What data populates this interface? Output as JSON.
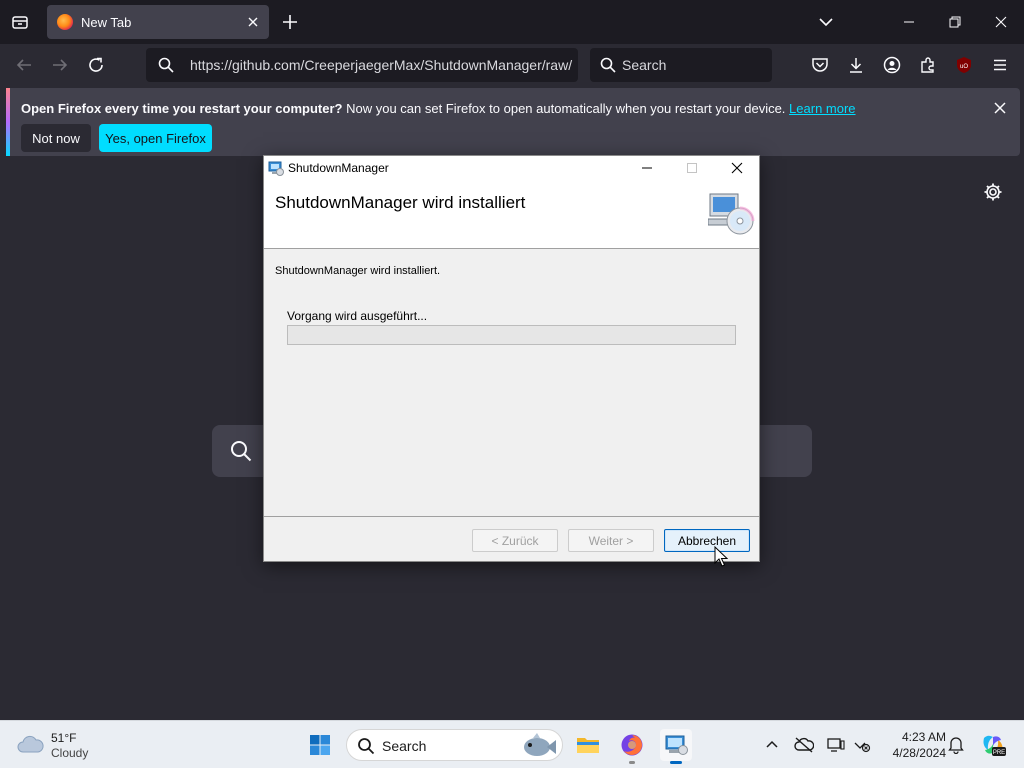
{
  "browser": {
    "tab_title": "New Tab",
    "url": "https://github.com/CreeperjaegerMax/ShutdownManager/raw/",
    "search_placeholder": "Search"
  },
  "notification": {
    "bold_text": "Open Firefox every time you restart your computer?",
    "text": " Now you can set Firefox to open automatically when you restart your device. ",
    "link": "Learn more",
    "not_now": "Not now",
    "yes": "Yes, open Firefox"
  },
  "dialog": {
    "window_title": "ShutdownManager",
    "header": "ShutdownManager wird installiert",
    "status": "ShutdownManager wird installiert.",
    "progress_label": "Vorgang wird ausgeführt...",
    "progress_fraction": 0,
    "back_button": "< Zurück",
    "next_button": "Weiter >",
    "cancel_button": "Abbrechen"
  },
  "taskbar": {
    "weather_temp": "51°F",
    "weather_condition": "Cloudy",
    "search_placeholder": "Search",
    "time": "4:23 AM",
    "date": "4/28/2024"
  },
  "colors": {
    "accent": "#00ddff",
    "browser_bg": "#2b2a33",
    "taskbar_bg": "#eaeef3",
    "dialog_bg": "#f0f0f0"
  }
}
